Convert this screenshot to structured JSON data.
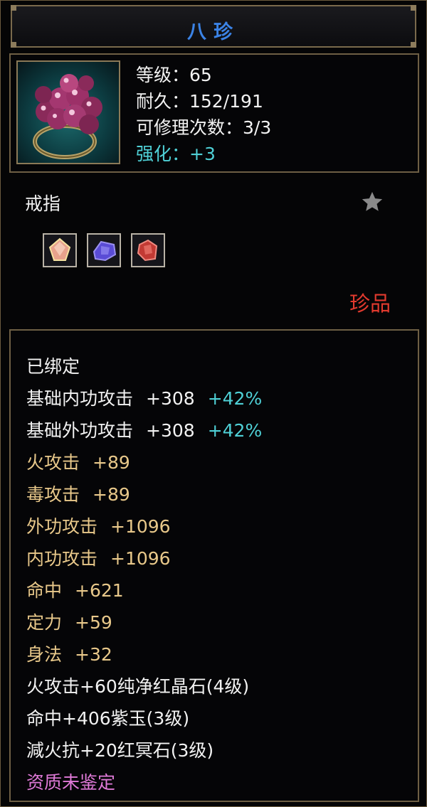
{
  "title": "八珍",
  "stats": {
    "level": "等级：65",
    "durability": "耐久：152/191",
    "repair": "可修理次数：3/3",
    "enhance": "强化：+3"
  },
  "item_type": "戒指",
  "rarity": "珍品",
  "gem_slots": [
    {
      "name": "pink-gem-icon",
      "color": "#e7a28c"
    },
    {
      "name": "purple-gem-icon",
      "color": "#5a4cd6"
    },
    {
      "name": "red-gem-icon",
      "color": "#c23a34"
    }
  ],
  "attributes": {
    "bound": "已绑定",
    "base_inner": {
      "label": "基础内功攻击",
      "value": "+308",
      "bonus": "+42%"
    },
    "base_outer": {
      "label": "基础外功攻击",
      "value": "+308",
      "bonus": "+42%"
    },
    "fire": {
      "label": "火攻击",
      "value": "+89"
    },
    "poison": {
      "label": "毒攻击",
      "value": "+89"
    },
    "outer": {
      "label": "外功攻击",
      "value": "+1096"
    },
    "inner": {
      "label": "内功攻击",
      "value": "+1096"
    },
    "hit": {
      "label": "命中",
      "value": "+621"
    },
    "focus": {
      "label": "定力",
      "value": "+59"
    },
    "agility": {
      "label": "身法",
      "value": "+32"
    },
    "gem1": "火攻击+60纯净红晶石(4级)",
    "gem2": "命中+406紫玉(3级)",
    "gem3": "減火抗+20红冥石(3级)",
    "quality": "资质未鉴定"
  },
  "colors": {
    "title": "#3b83e6",
    "cyan": "#4fd0d6",
    "gold": "#e8c88a",
    "rarity": "#e23a2e",
    "quality": "#e07ad8"
  }
}
